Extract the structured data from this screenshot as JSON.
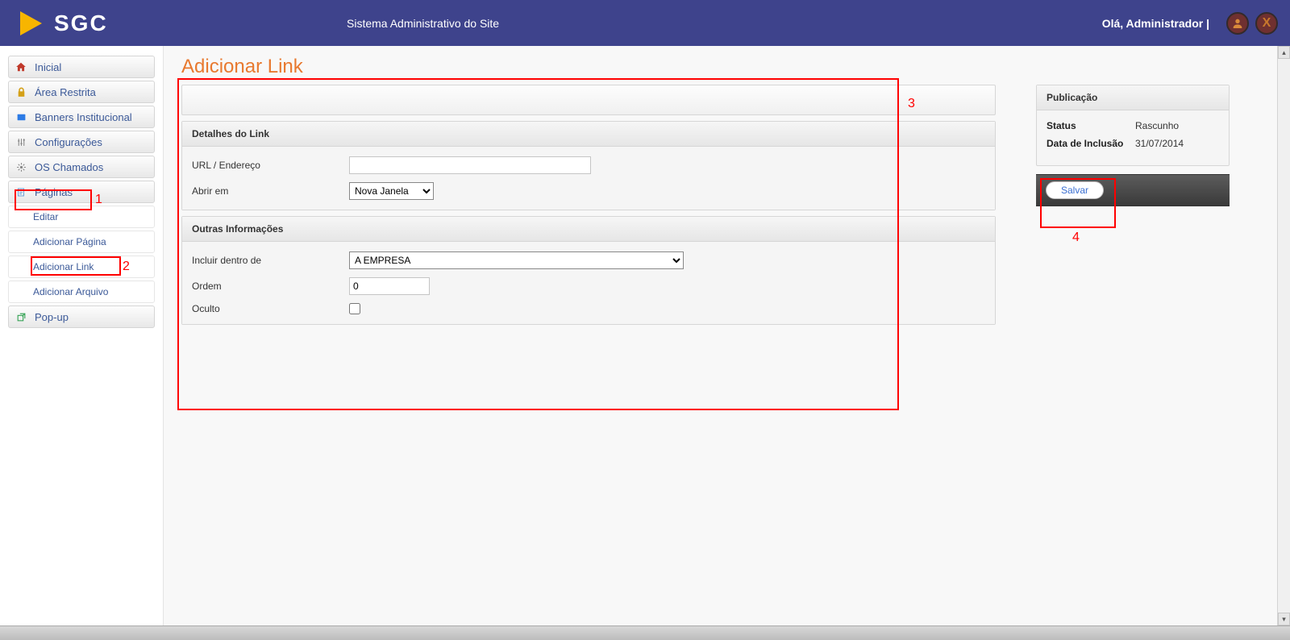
{
  "header": {
    "logo_text": "SGC",
    "subtitle": "Sistema Administrativo do Site",
    "greeting": "Olá, Administrador  |"
  },
  "sidebar": {
    "items": [
      {
        "label": "Inicial"
      },
      {
        "label": "Área Restrita"
      },
      {
        "label": "Banners Institucional"
      },
      {
        "label": "Configurações"
      },
      {
        "label": "OS Chamados"
      },
      {
        "label": "Páginas"
      }
    ],
    "sub_items": [
      {
        "label": "Editar"
      },
      {
        "label": "Adicionar Página"
      },
      {
        "label": "Adicionar Link"
      },
      {
        "label": "Adicionar Arquivo"
      }
    ],
    "popup_label": "Pop-up"
  },
  "page": {
    "title": "Adicionar Link"
  },
  "form": {
    "panel1_title": "Detalhes do Link",
    "url_label": "URL / Endereço",
    "url_value": "",
    "abrir_label": "Abrir em",
    "abrir_value": "Nova Janela",
    "panel2_title": "Outras Informações",
    "incluir_label": "Incluir dentro de",
    "incluir_value": "A EMPRESA",
    "ordem_label": "Ordem",
    "ordem_value": "0",
    "oculto_label": "Oculto"
  },
  "pub": {
    "title": "Publicação",
    "status_k": "Status",
    "status_v": "Rascunho",
    "data_k": "Data de Inclusão",
    "data_v": "31/07/2014",
    "save": "Salvar"
  },
  "annotations": {
    "n1": "1",
    "n2": "2",
    "n3": "3",
    "n4": "4"
  }
}
